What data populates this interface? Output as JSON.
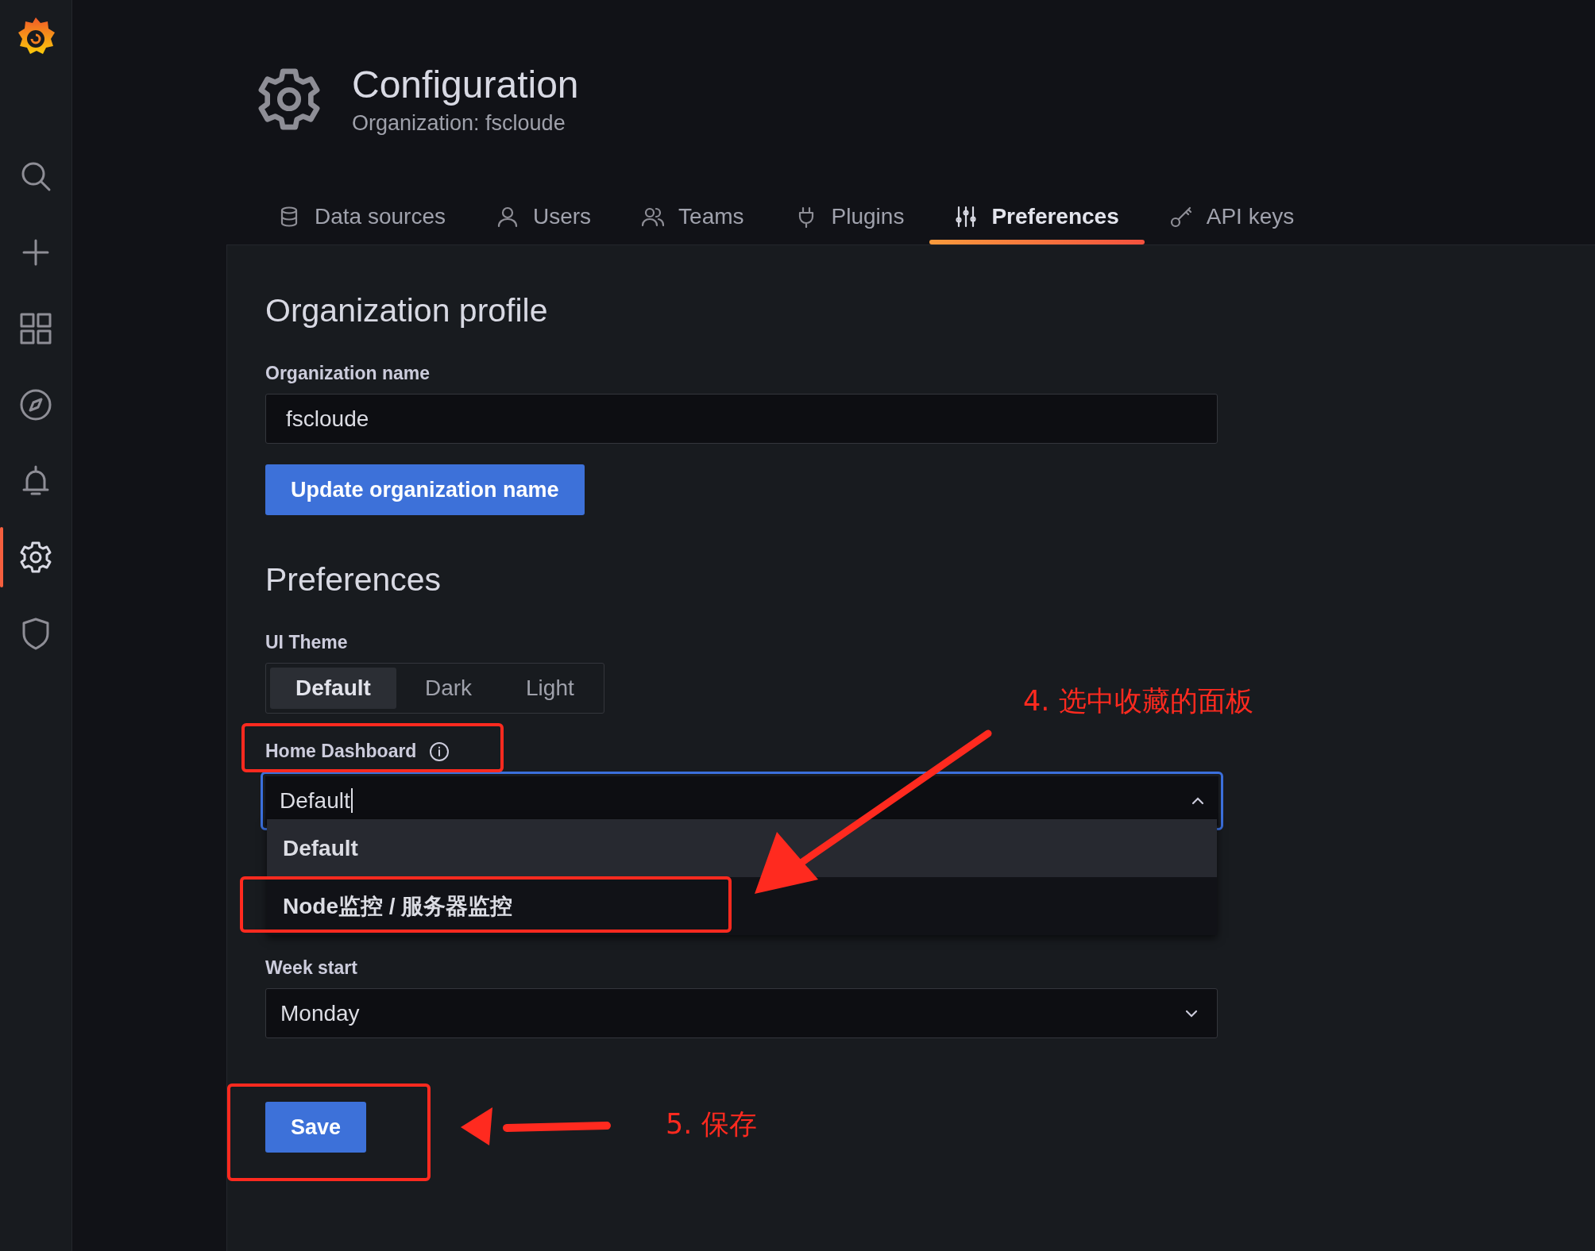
{
  "sidebar": {
    "items": [
      {
        "kind": "logo",
        "selected": false
      },
      {
        "kind": "search",
        "selected": false
      },
      {
        "kind": "plus",
        "selected": false
      },
      {
        "kind": "grid",
        "selected": false
      },
      {
        "kind": "compass",
        "selected": false
      },
      {
        "kind": "bell",
        "selected": false
      },
      {
        "kind": "gear",
        "selected": true
      },
      {
        "kind": "shield",
        "selected": false
      }
    ]
  },
  "header": {
    "title": "Configuration",
    "subtitle": "Organization: fscloude"
  },
  "tabs": [
    {
      "label": "Data sources",
      "kind": "database",
      "selected": false
    },
    {
      "label": "Users",
      "kind": "user",
      "selected": false
    },
    {
      "label": "Teams",
      "kind": "users",
      "selected": false
    },
    {
      "label": "Plugins",
      "kind": "plug",
      "selected": false
    },
    {
      "label": "Preferences",
      "kind": "sliders",
      "selected": true
    },
    {
      "label": "API keys",
      "kind": "key",
      "selected": false
    }
  ],
  "org_profile": {
    "heading": "Organization profile",
    "name_label": "Organization name",
    "name_value": "fscloude",
    "button": "Update organization name"
  },
  "preferences": {
    "heading": "Preferences",
    "theme_label": "UI Theme",
    "theme_options": [
      {
        "label": "Default",
        "selected": true
      },
      {
        "label": "Dark",
        "selected": false
      },
      {
        "label": "Light",
        "selected": false
      }
    ],
    "home_dashboard": {
      "label": "Home Dashboard",
      "value": "Default",
      "expanded": true,
      "options": [
        {
          "label": "Default",
          "selected": true
        },
        {
          "label": "Node监控 / 服务器监控",
          "selected": false
        }
      ]
    },
    "week_start": {
      "label": "Week start",
      "value": "Monday"
    },
    "save_button": "Save"
  },
  "annotations": [
    {
      "text": "4. 选中收藏的面板"
    },
    {
      "text": "5. 保存"
    }
  ]
}
